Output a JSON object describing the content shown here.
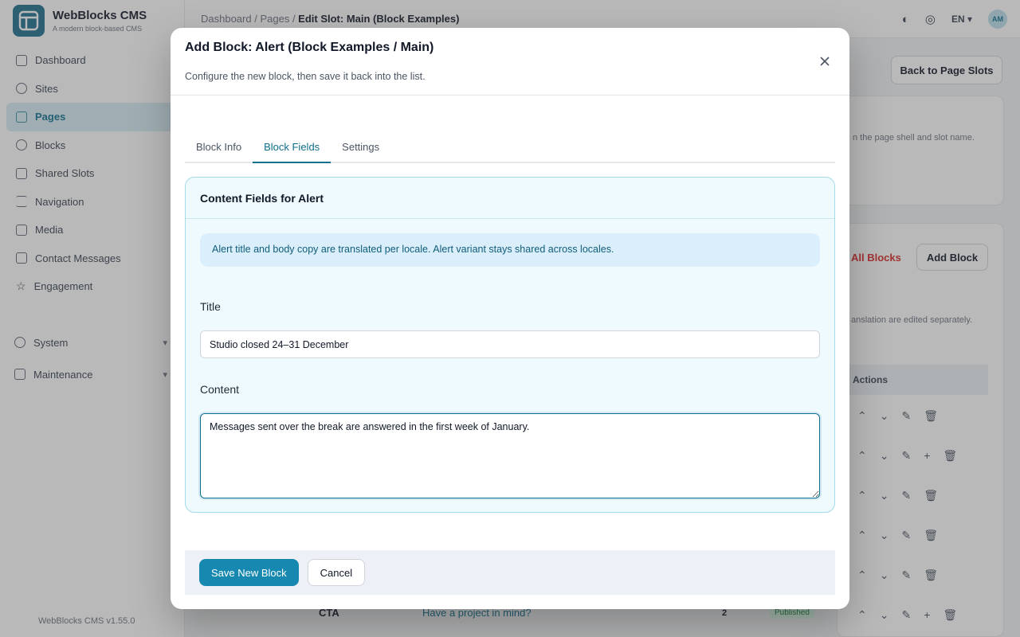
{
  "app": {
    "name": "WebBlocks CMS",
    "tagline": "A modern block-based CMS",
    "version": "WebBlocks CMS v1.55.0"
  },
  "sidebar": {
    "items": [
      {
        "label": "Dashboard",
        "icon": "grid-icon"
      },
      {
        "label": "Sites",
        "icon": "globe-icon"
      },
      {
        "label": "Pages",
        "icon": "page-icon",
        "active": true
      },
      {
        "label": "Blocks",
        "icon": "blocks-icon"
      },
      {
        "label": "Shared Slots",
        "icon": "stack-icon"
      },
      {
        "label": "Navigation",
        "icon": "menu-icon"
      },
      {
        "label": "Media",
        "icon": "image-icon"
      },
      {
        "label": "Contact Messages",
        "icon": "mail-icon"
      },
      {
        "label": "Engagement",
        "icon": "star-icon"
      }
    ],
    "groups": [
      {
        "label": "System"
      },
      {
        "label": "Maintenance"
      }
    ]
  },
  "topbar": {
    "breadcrumb": [
      "Dashboard",
      "Pages",
      "Edit Slot: Main (Block Examples)"
    ],
    "locale": "EN",
    "avatar_initials": "AM"
  },
  "background": {
    "back_button": "Back to Page Slots",
    "slot_hint": "n the page shell and slot name.",
    "delete_all": "All Blocks",
    "add_block": "Add Block",
    "translation_note": "anslation are edited separately.",
    "actions_header": "Actions",
    "cta_type": "CTA",
    "cta_title": "Have a project in mind?",
    "cta_count": "2",
    "cta_status": "Published"
  },
  "modal": {
    "title": "Add Block: Alert (Block Examples / Main)",
    "subtitle": "Configure the new block, then save it back into the list.",
    "tabs": [
      {
        "label": "Block Info"
      },
      {
        "label": "Block Fields",
        "active": true
      },
      {
        "label": "Settings"
      }
    ],
    "fields_card": {
      "title": "Content Fields for Alert",
      "info": "Alert title and body copy are translated per locale. Alert variant stays shared across locales.",
      "title_label": "Title",
      "title_value": "Studio closed 24–31 December",
      "content_label": "Content",
      "content_value": "Messages sent over the break are answered in the first week of January."
    },
    "footer": {
      "save_label": "Save New Block",
      "cancel_label": "Cancel"
    }
  },
  "colors": {
    "accent": "#1789b0",
    "accent_dark": "#0f6f8f",
    "card_bg": "#eefafd",
    "info_bg": "#dbeefb"
  }
}
